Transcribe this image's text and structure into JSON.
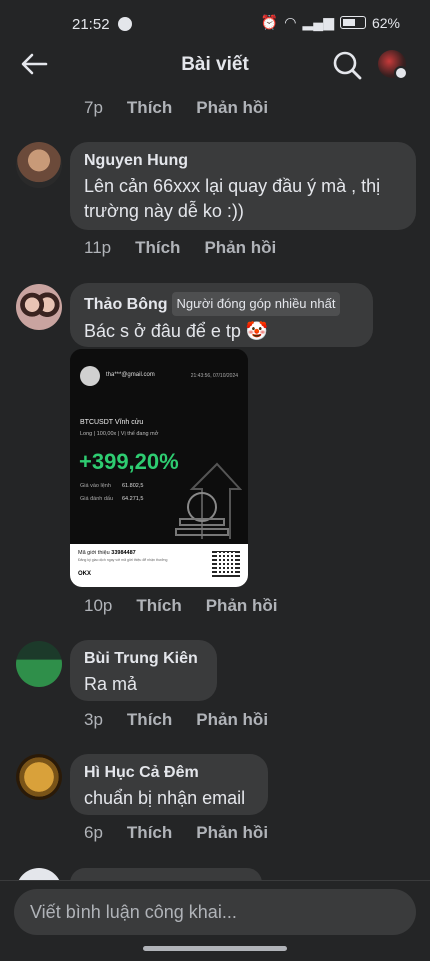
{
  "status_bar": {
    "time": "21:52",
    "battery": "62%"
  },
  "header": {
    "title": "Bài viết"
  },
  "actions": {
    "like": "Thích",
    "reply": "Phản hồi"
  },
  "top_actions": {
    "time": "7p"
  },
  "comments": [
    {
      "author": "Nguyen Hung",
      "text_line1": "Lên cản 66xxx lại quay đầu ý mà , thị",
      "text_line2": "trường này dễ ko :))",
      "time": "11p"
    },
    {
      "author": "Thảo Bông",
      "badge": "Người đóng góp nhiều nhất",
      "text": "Bác s ở đâu để e tp 🤡",
      "time": "10p",
      "image": {
        "email": "tha***@gmail.com",
        "date": "21:43:56, 07/10/2024",
        "pair": "BTCUSDT Vĩnh cửu",
        "details": "Long | 100,00x | Vị thế đang mở",
        "pnl": "+399,20%",
        "entry_label": "Giá vào lệnh",
        "entry_value": "61.802,5",
        "mark_label": "Giá đánh dấu",
        "mark_value": "64.271,5",
        "ref_label": "Mã giới thiệu",
        "ref_code": "33984487",
        "fine_print": "Đăng ký giao dịch ngay với mã giới thiệu để nhận thưởng",
        "logo": "OKX"
      }
    },
    {
      "author": "Bùi Trung Kiên",
      "text": "Ra mả",
      "time": "3p"
    },
    {
      "author": "Hì Hục Cả Đêm",
      "text": "chuẩn bị nhận email",
      "time": "6p"
    }
  ],
  "composer": {
    "placeholder": "Viết bình luận công khai..."
  },
  "colors": {
    "background": "#242526",
    "bubble": "#3a3b3c",
    "pnl_green": "#2ecc71"
  }
}
